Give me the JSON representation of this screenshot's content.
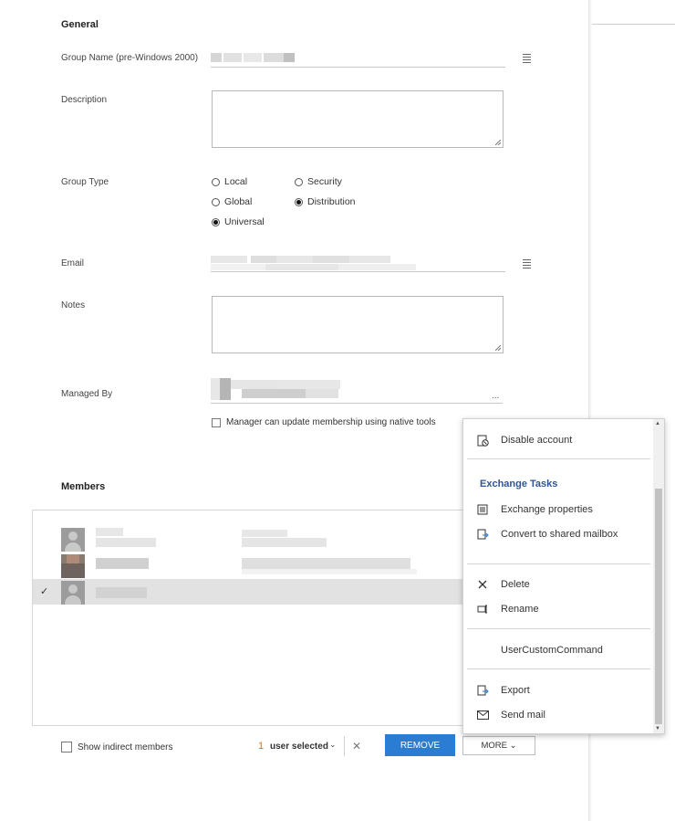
{
  "general": {
    "title": "General",
    "group_name_label": "Group Name (pre-Windows 2000)",
    "description_label": "Description",
    "group_type_label": "Group Type",
    "group_type_options": [
      {
        "label": "Local",
        "selected": false
      },
      {
        "label": "Security",
        "selected": false
      },
      {
        "label": "Global",
        "selected": false
      },
      {
        "label": "Distribution",
        "selected": true
      },
      {
        "label": "Universal",
        "selected": true
      }
    ],
    "email_label": "Email",
    "notes_label": "Notes",
    "managed_by_label": "Managed By",
    "managed_by_browse": "...",
    "manager_update_label": "Manager can update membership using native tools"
  },
  "members": {
    "title": "Members",
    "rows": [
      {
        "selected": false
      },
      {
        "selected": false
      },
      {
        "selected": true
      }
    ],
    "check_glyph": "✓"
  },
  "footer": {
    "show_indirect_label": "Show indirect members",
    "selected_count": "1",
    "selected_label": "user selected",
    "chevron": "⌄",
    "clear_glyph": "✕",
    "remove_label": "REMOVE",
    "more_label": "MORE ⌄"
  },
  "context_menu": {
    "disable_account": "Disable account",
    "exchange_heading": "Exchange Tasks",
    "exchange_properties": "Exchange properties",
    "convert_shared": "Convert to shared mailbox",
    "delete": "Delete",
    "rename": "Rename",
    "custom_command": "UserCustomCommand",
    "export": "Export",
    "send_mail": "Send mail"
  },
  "colors": {
    "accent": "#2b7cd3",
    "heading_blue": "#2f5597",
    "count_orange": "#d4711c"
  }
}
